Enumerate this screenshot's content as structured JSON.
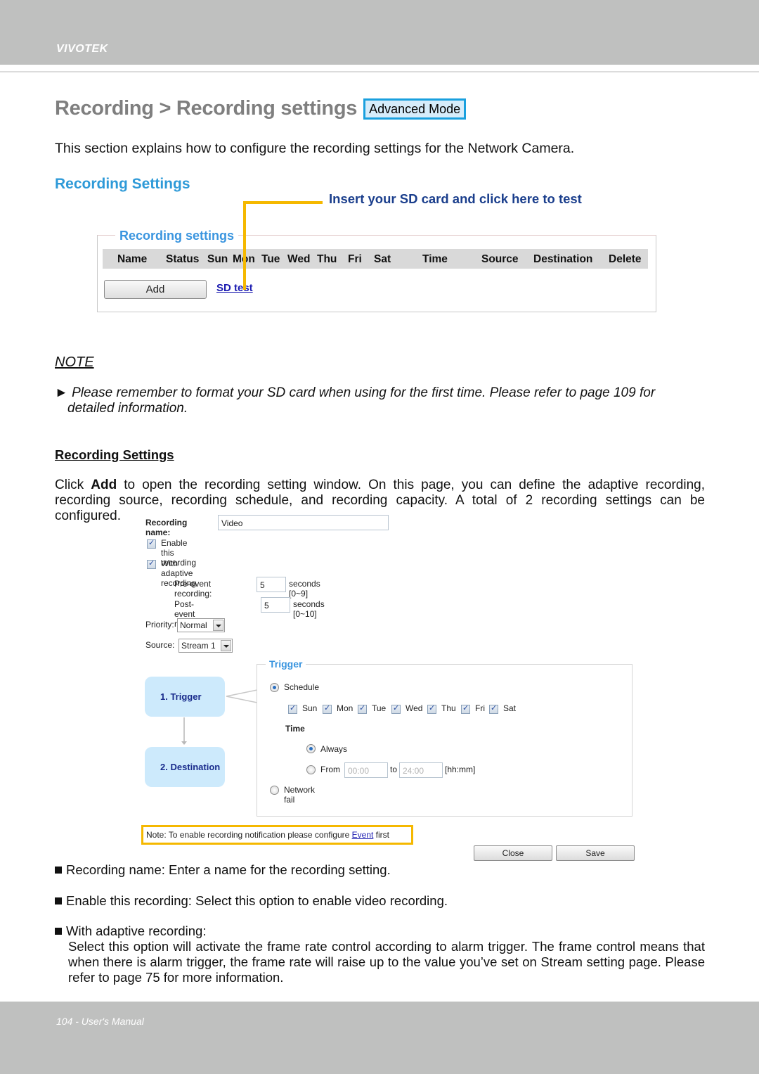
{
  "header": {
    "brand": "VIVOTEK"
  },
  "title": {
    "text": "Recording > Recording settings",
    "badge": "Advanced Mode"
  },
  "intro": "This section explains how to configure the recording settings for the Network Camera.",
  "section_heading": "Recording Settings",
  "callout": "Insert your SD card and click here to test",
  "recording_table": {
    "legend": "Recording settings",
    "columns": [
      "Name",
      "Status",
      "Sun",
      "Mon",
      "Tue",
      "Wed",
      "Thu",
      "Fri",
      "Sat",
      "Time",
      "Source",
      "Destination",
      "Delete"
    ],
    "add_label": "Add",
    "sd_test_label": "SD test"
  },
  "note": {
    "title": "NOTE",
    "bullet": "►",
    "line1": "Please remember to format your SD card when using for the first time. Please refer to page 109 for",
    "line2": "detailed information."
  },
  "sub_heading": "Recording Settings",
  "paragraph": {
    "pre": "Click ",
    "bold": "Add",
    "post": " to open the recording setting window. On this page, you can define the adaptive recording, recording source, recording schedule, and recording capacity. A total of 2 recording settings can be configured."
  },
  "form": {
    "name_label": "Recording name:",
    "name_value": "Video",
    "enable_label": "Enable this recording",
    "enable_checked": true,
    "adaptive_label": "With adaptive recording",
    "adaptive_checked": true,
    "pre_event_label": "Pre-event recording:",
    "pre_event_value": "5",
    "pre_event_unit": "seconds [0~9]",
    "post_event_label": "Post-event recording:",
    "post_event_value": "5",
    "post_event_unit": "seconds [0~10]",
    "priority_label": "Priority:",
    "priority_value": "Normal",
    "source_label": "Source:",
    "source_value": "Stream 1",
    "steps": [
      "1.  Trigger",
      "2.  Destination"
    ],
    "trigger": {
      "legend": "Trigger",
      "schedule_label": "Schedule",
      "days": [
        "Sun",
        "Mon",
        "Tue",
        "Wed",
        "Thu",
        "Fri",
        "Sat"
      ],
      "time_label": "Time",
      "always_label": "Always",
      "from_label": "From",
      "from_value": "00:00",
      "to_label": "to",
      "to_value": "24:00",
      "format_label": "[hh:mm]",
      "network_fail_label": "Network fail"
    },
    "event_note": {
      "pre": "Note: To enable recording notification please configure ",
      "link": "Event",
      "post": " first"
    },
    "close_label": "Close",
    "save_label": "Save"
  },
  "bullets": [
    "Recording name: Enter a name for the recording setting.",
    "Enable this recording: Select this option to enable video recording.",
    "With adaptive recording:"
  ],
  "bullet_body": "Select this option will activate the frame rate control according to alarm trigger. The frame control means that when there is alarm trigger, the frame rate will raise up to the value you’ve set on Stream setting page. Please refer to page 75 for more information.",
  "footer": {
    "text": "104 - User's Manual"
  },
  "colors": {
    "accent_blue": "#2e9ad8",
    "callout_yellow": "#f5b800",
    "band_gray": "#bfc0bf",
    "title_gray": "#7f7f7f"
  }
}
